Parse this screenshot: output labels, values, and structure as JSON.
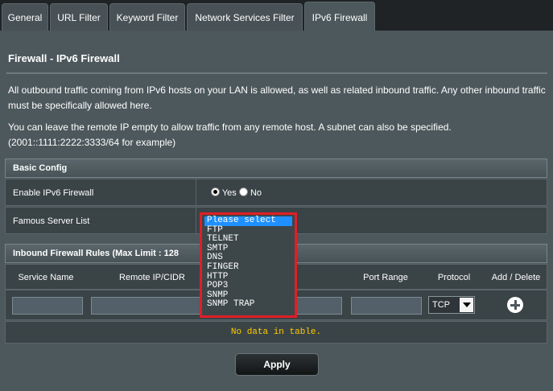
{
  "tabs": [
    {
      "label": "General"
    },
    {
      "label": "URL Filter"
    },
    {
      "label": "Keyword Filter"
    },
    {
      "label": "Network Services Filter"
    },
    {
      "label": "IPv6 Firewall"
    }
  ],
  "page_title": "Firewall - IPv6 Firewall",
  "description1": "All outbound traffic coming from IPv6 hosts on your LAN is allowed, as well as related inbound traffic. Any other inbound traffic must be specifically allowed here.",
  "description2": "You can leave the remote IP empty to allow traffic from any remote host. A subnet can also be specified. (2001::1111:2222:3333/64 for example)",
  "basic_config": {
    "header": "Basic Config",
    "enable_label": "Enable IPv6 Firewall",
    "yes_label": "Yes",
    "no_label": "No",
    "enabled": true,
    "famous_label": "Famous Server List"
  },
  "dropdown": {
    "options": [
      "Please select",
      "FTP",
      "TELNET",
      "SMTP",
      "DNS",
      "FINGER",
      "HTTP",
      "POP3",
      "SNMP",
      "SNMP TRAP"
    ],
    "highlighted": "Please select"
  },
  "rules": {
    "header": "Inbound Firewall Rules (Max Limit : 128",
    "columns": [
      "Service Name",
      "Remote IP/CIDR",
      "Port Range",
      "Protocol",
      "Add / Delete"
    ],
    "protocol_value": "TCP",
    "empty_text": "No data in table."
  },
  "apply_label": "Apply",
  "colors": {
    "accent_red": "#e01e26",
    "highlight_blue": "#1e90ff",
    "nodata_yellow": "#ffcc00"
  }
}
